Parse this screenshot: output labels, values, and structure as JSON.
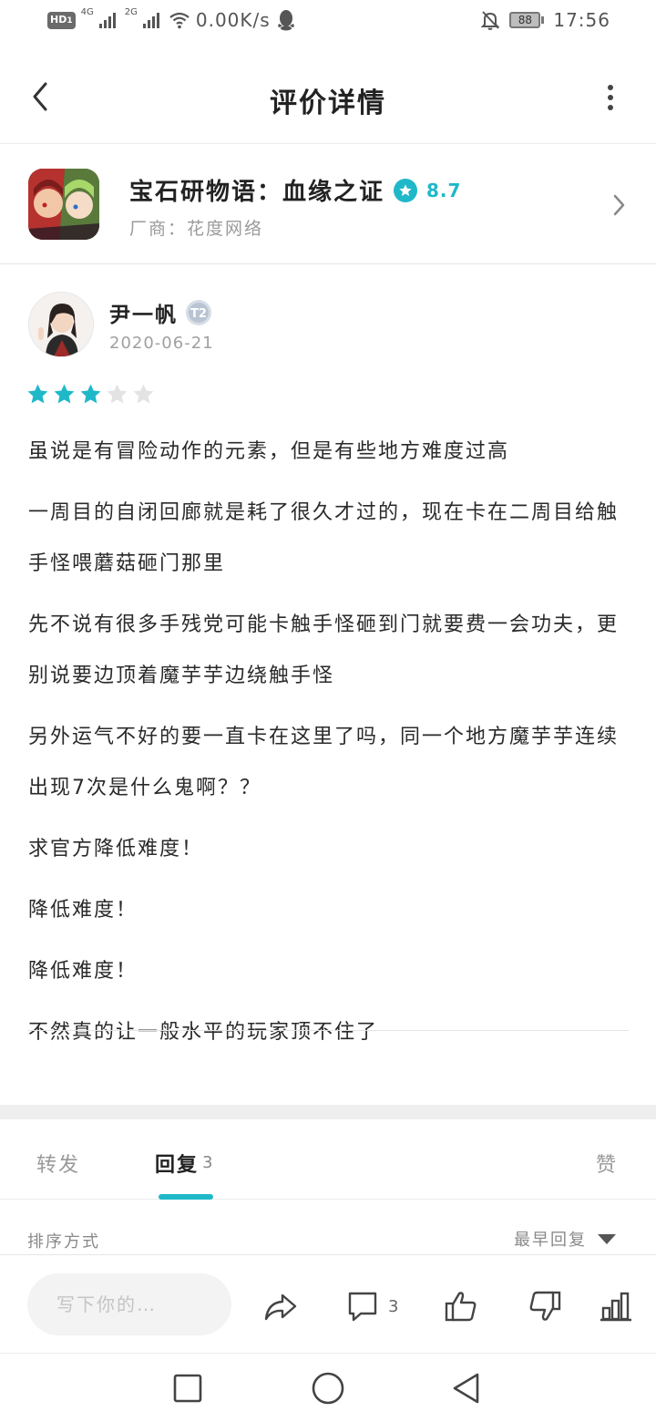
{
  "status_bar": {
    "hd": "HD",
    "hd_sub": "1",
    "net1": "4G",
    "net2": "2G",
    "speed": "0.00K/s",
    "battery": "88",
    "time": "17:56"
  },
  "header": {
    "title": "评价详情"
  },
  "game": {
    "title": "宝石研物语：血缘之证",
    "score": "8.7",
    "vendor": "厂商：花度网络"
  },
  "review": {
    "user_name": "尹一帆",
    "level_badge": "T2",
    "date": "2020-06-21",
    "rating": 3,
    "rating_max": 5,
    "paragraphs": [
      "虽说是有冒险动作的元素，但是有些地方难度过高",
      "一周目的自闭回廊就是耗了很久才过的，现在卡在二周目给触手怪喂蘑菇砸门那里",
      "先不说有很多手残党可能卡触手怪砸到门就要费一会功夫，更别说要边顶着魔芋芋边绕触手怪",
      "另外运气不好的要一直卡在这里了吗，同一个地方魔芋芋连续出现7次是什么鬼啊？？",
      "求官方降低难度！",
      "降低难度！",
      "降低难度！",
      "不然真的让一般水平的玩家顶不住了"
    ]
  },
  "tabs": {
    "forward": "转发",
    "reply": "回复",
    "reply_count": "3",
    "like": "赞"
  },
  "sort": {
    "label": "排序方式",
    "value": "最早回复"
  },
  "action_bar": {
    "input_placeholder": "写下你的…",
    "comment_count": "3"
  },
  "colors": {
    "accent": "#1fb8c9",
    "star_empty": "#e3e3e3",
    "divider": "#ececec"
  }
}
